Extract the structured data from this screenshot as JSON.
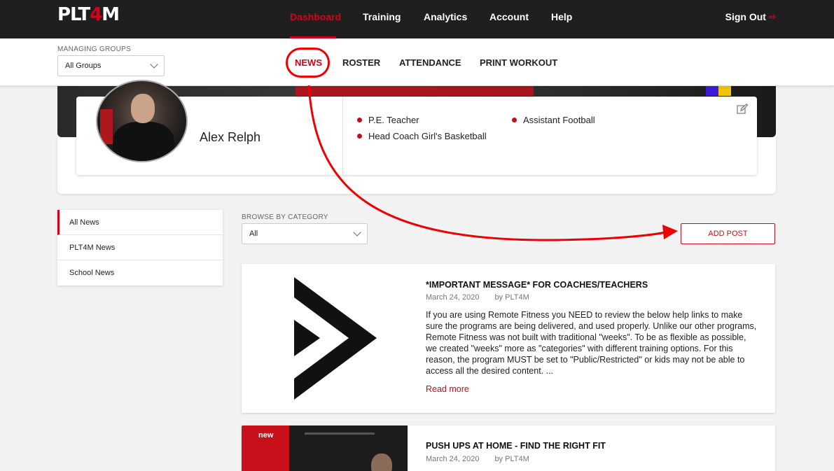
{
  "brand": {
    "logo_prefix": "PLT",
    "logo_four": "4",
    "logo_suffix": "M"
  },
  "topnav": {
    "items": [
      {
        "label": "Dashboard",
        "active": true
      },
      {
        "label": "Training"
      },
      {
        "label": "Analytics"
      },
      {
        "label": "Account"
      },
      {
        "label": "Help"
      }
    ],
    "signout": "Sign Out"
  },
  "subnav": {
    "managing_label": "MANAGING GROUPS",
    "groups_value": "All Groups",
    "items": [
      {
        "label": "NEWS",
        "active": true
      },
      {
        "label": "ROSTER"
      },
      {
        "label": "ATTENDANCE"
      },
      {
        "label": "PRINT WORKOUT"
      }
    ]
  },
  "profile": {
    "name": "Alex Relph",
    "roles": [
      "P.E. Teacher",
      "Assistant Football",
      "Head Coach Girl's Basketball"
    ]
  },
  "categories": {
    "items": [
      "All News",
      "PLT4M News",
      "School News"
    ],
    "browse_label": "BROWSE BY CATEGORY",
    "browse_value": "All"
  },
  "add_post_label": "ADD POST",
  "posts": [
    {
      "title": "*IMPORTANT MESSAGE* FOR COACHES/TEACHERS",
      "date": "March 24, 2020",
      "author": "by PLT4M",
      "body": "If you are using Remote Fitness you NEED to review the below help links to make sure the programs are being delivered, and used properly. Unlike our other programs, Remote Fitness was not built with traditional \"weeks\". To be as flexible as possible, we created \"weeks\" more as \"categories\" with different training options. For this reason, the program MUST be set to \"Public/Restricted\" or kids may not be able to access all the desired content. ...",
      "read_more": "Read more"
    },
    {
      "badge": "new",
      "title": "PUSH UPS AT HOME - FIND THE RIGHT FIT",
      "date": "March 24, 2020",
      "author": "by PLT4M"
    }
  ],
  "colors": {
    "accent": "#d0021b",
    "annotation": "#ee0000",
    "topbar": "#1f1f1f"
  },
  "icons": [
    "sign-out-icon",
    "chevron-down-icon",
    "edit-icon",
    "plt4m-logo-icon"
  ]
}
